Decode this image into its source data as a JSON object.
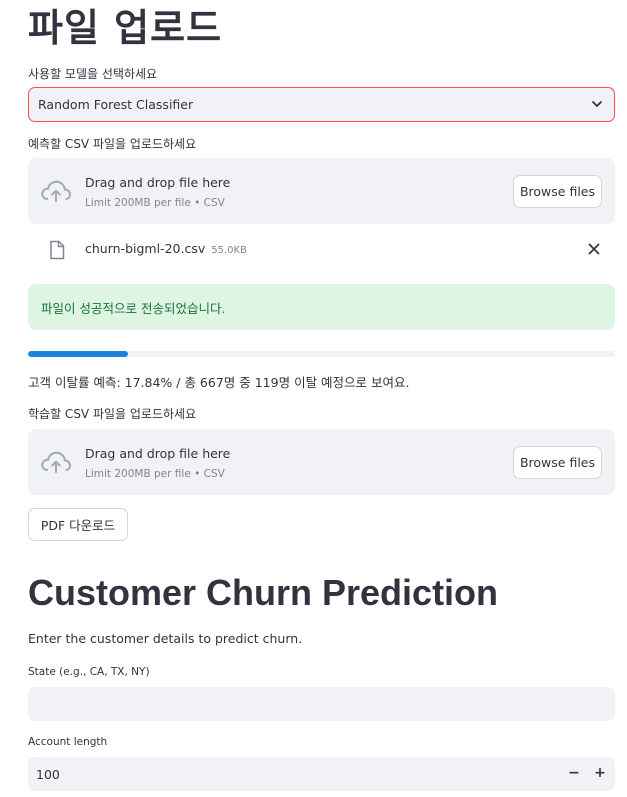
{
  "upload": {
    "title": "파일 업로드",
    "model_label": "사용할 모델을 선택하세요",
    "model_selected": "Random Forest Classifier",
    "predict_csv_label": "예측할 CSV 파일을 업로드하세요",
    "dropzone": {
      "main": "Drag and drop file here",
      "sub": "Limit 200MB per file • CSV",
      "browse": "Browse files"
    },
    "uploaded_file": {
      "name": "churn-bigml-20.csv",
      "size": "55.0KB"
    },
    "success_message": "파일이 성공적으로 전송되었습니다.",
    "progress": 0.17,
    "result_text": "고객 이탈률 예측: 17.84% / 총 667명 중 119명 이탈 예정으로 보여요.",
    "train_csv_label": "학습할 CSV 파일을 업로드하세요",
    "pdf_button": "PDF 다운로드"
  },
  "churn": {
    "title": "Customer Churn Prediction",
    "description": "Enter the customer details to predict churn.",
    "state_label": "State (e.g., CA, TX, NY)",
    "state_value": "",
    "account_length_label": "Account length",
    "account_length_value": "100",
    "minus": "−",
    "plus": "+"
  },
  "colors": {
    "accent": "#ff4b4b",
    "progress": "#1c83e1",
    "success_bg": "#dff5e4",
    "success_text": "#177233",
    "field_bg": "#f0f2f6"
  },
  "icons": {
    "upload": "cloud-upload-icon",
    "file": "file-icon",
    "close": "close-icon",
    "chevron": "chevron-down-icon"
  }
}
